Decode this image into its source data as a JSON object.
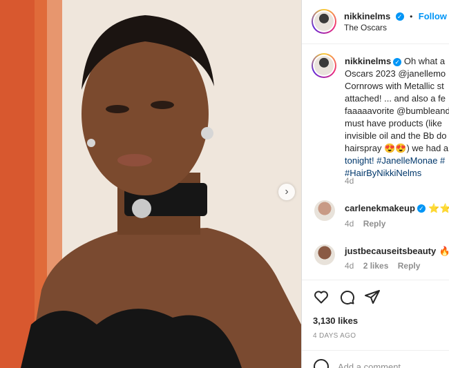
{
  "post": {
    "author": "nikkinelms",
    "follow_label": "Follow",
    "separator": "•",
    "location": "The Oscars",
    "next_glyph": "›"
  },
  "caption": {
    "username": "nikkinelms",
    "lines": [
      "Oh what a",
      "Oscars 2023 @janellemo",
      "Cornrows with Metallic st",
      "attached! ... and also a fe",
      "faaaaavorite @bumbleand",
      "must have products (like",
      "invisible oil and the Bb do",
      "hairspray 😍😍) we had a",
      "tonight! #JanelleMonae #",
      "#HairByNikkiNelms"
    ],
    "time": "4d"
  },
  "comments": [
    {
      "username": "carlenekmakeup",
      "text": "⭐⭐",
      "time": "4d",
      "reply_label": "Reply",
      "likes": ""
    },
    {
      "username": "justbecauseitsbeauty",
      "text": "🔥",
      "time": "4d",
      "likes": "2 likes",
      "reply_label": "Reply"
    }
  ],
  "actions": {
    "likes_count": "3,130 likes",
    "date": "4 DAYS AGO",
    "comment_placeholder": "Add a comment..."
  },
  "icons": {
    "heart": "heart-icon",
    "comment": "comment-icon",
    "share": "share-icon",
    "emoji": "emoji-icon"
  },
  "colors": {
    "accent": "#0095f6",
    "link": "#00376b",
    "muted": "#8e8e8e",
    "text": "#262626"
  }
}
